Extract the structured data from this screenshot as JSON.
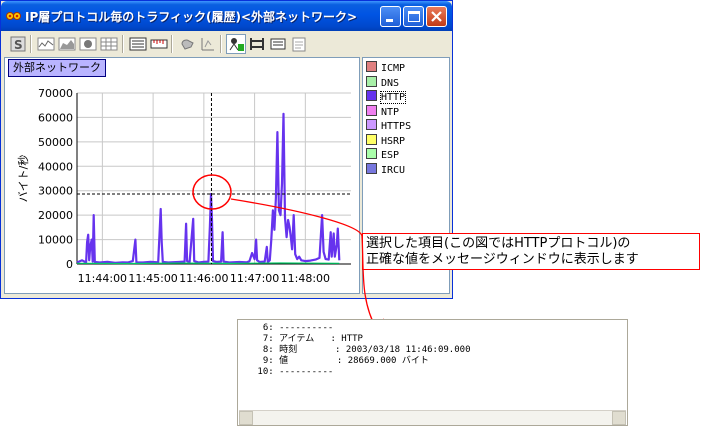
{
  "window": {
    "title": "IP層プロトコル毎のトラフィック(履歴)<外部ネットワーク>",
    "title_bar_color": "#0054e3"
  },
  "toolbar": {
    "buttons": [
      {
        "name": "summary-icon"
      },
      {
        "name": "line-graph-icon"
      },
      {
        "name": "area-graph-icon"
      },
      {
        "name": "pie-graph-icon"
      },
      {
        "name": "table-icon"
      },
      {
        "name": "list-view-icon"
      },
      {
        "name": "ruler-icon"
      },
      {
        "name": "hand-icon"
      },
      {
        "name": "zoom-icon"
      },
      {
        "name": "legend-icon"
      },
      {
        "name": "bars-icon"
      },
      {
        "name": "settings-icon"
      },
      {
        "name": "notepad-icon"
      }
    ]
  },
  "graph": {
    "series_label": "外部ネットワーク"
  },
  "chart_data": {
    "type": "line",
    "title": "外部ネットワーク",
    "ylabel": "バイト/秒",
    "xlabel": "",
    "ylim": [
      0,
      70000
    ],
    "yticks": [
      0,
      10000,
      20000,
      30000,
      40000,
      50000,
      60000,
      70000
    ],
    "xlim_min": [
      43.5,
      48.9
    ],
    "xtick_labels": [
      "11:44:00",
      "11:45:00",
      "11:46:00",
      "11:47:00",
      "11:48:00"
    ],
    "xtick_min": [
      44,
      45,
      46,
      47,
      48
    ],
    "grid": true,
    "cursor_min": 46.15,
    "reference_y": 28669,
    "series": [
      {
        "name": "HTTP",
        "color": "#6633ee",
        "points": [
          [
            43.5,
            600
          ],
          [
            43.6,
            1500
          ],
          [
            43.68,
            600
          ],
          [
            43.7,
            9000
          ],
          [
            43.72,
            12000
          ],
          [
            43.74,
            1500
          ],
          [
            43.76,
            7000
          ],
          [
            43.79,
            10000
          ],
          [
            43.81,
            1000
          ],
          [
            43.83,
            20000
          ],
          [
            43.85,
            800
          ],
          [
            43.95,
            600
          ],
          [
            44.1,
            900
          ],
          [
            44.25,
            500
          ],
          [
            44.4,
            700
          ],
          [
            44.5,
            600
          ],
          [
            44.6,
            1200
          ],
          [
            44.65,
            10000
          ],
          [
            44.67,
            700
          ],
          [
            44.8,
            600
          ],
          [
            44.95,
            900
          ],
          [
            45.1,
            700
          ],
          [
            45.15,
            22500
          ],
          [
            45.17,
            9000
          ],
          [
            45.19,
            800
          ],
          [
            45.3,
            600
          ],
          [
            45.5,
            800
          ],
          [
            45.62,
            1000
          ],
          [
            45.65,
            16500
          ],
          [
            45.67,
            1200
          ],
          [
            45.72,
            800
          ],
          [
            45.79,
            18500
          ],
          [
            45.81,
            1200
          ],
          [
            45.9,
            600
          ],
          [
            46.0,
            900
          ],
          [
            46.09,
            1000
          ],
          [
            46.12,
            15500
          ],
          [
            46.14,
            28669
          ],
          [
            46.16,
            18000
          ],
          [
            46.18,
            1200
          ],
          [
            46.25,
            800
          ],
          [
            46.34,
            1000
          ],
          [
            46.37,
            13000
          ],
          [
            46.39,
            1000
          ],
          [
            46.5,
            600
          ],
          [
            46.7,
            800
          ],
          [
            46.85,
            700
          ],
          [
            46.9,
            1200
          ],
          [
            46.95,
            4500
          ],
          [
            47.0,
            2000
          ],
          [
            47.03,
            10000
          ],
          [
            47.05,
            1500
          ],
          [
            47.1,
            800
          ],
          [
            47.2,
            1000
          ],
          [
            47.24,
            7000
          ],
          [
            47.26,
            800
          ],
          [
            47.3,
            1500
          ],
          [
            47.33,
            10000
          ],
          [
            47.36,
            22000
          ],
          [
            47.39,
            14000
          ],
          [
            47.42,
            27000
          ],
          [
            47.45,
            54000
          ],
          [
            47.48,
            22000
          ],
          [
            47.51,
            20000
          ],
          [
            47.54,
            33000
          ],
          [
            47.57,
            61500
          ],
          [
            47.6,
            19000
          ],
          [
            47.63,
            11000
          ],
          [
            47.66,
            18000
          ],
          [
            47.69,
            15000
          ],
          [
            47.72,
            10000
          ],
          [
            47.74,
            6000
          ],
          [
            47.77,
            20000
          ],
          [
            47.8,
            4000
          ],
          [
            47.84,
            2000
          ],
          [
            47.88,
            3000
          ],
          [
            47.92,
            1500
          ],
          [
            48.0,
            1200
          ],
          [
            48.1,
            1400
          ],
          [
            48.2,
            1800
          ],
          [
            48.28,
            2500
          ],
          [
            48.33,
            20000
          ],
          [
            48.36,
            5000
          ],
          [
            48.4,
            2000
          ],
          [
            48.46,
            1800
          ],
          [
            48.5,
            13000
          ],
          [
            48.52,
            3000
          ],
          [
            48.56,
            12500
          ],
          [
            48.58,
            3000
          ],
          [
            48.62,
            8000
          ],
          [
            48.64,
            14500
          ],
          [
            48.67,
            1500
          ]
        ]
      },
      {
        "name": "DNS",
        "color": "#00cc66",
        "points": [
          [
            43.5,
            300
          ],
          [
            44.5,
            200
          ],
          [
            45.5,
            350
          ],
          [
            46.5,
            250
          ],
          [
            47.5,
            400
          ],
          [
            48.67,
            300
          ]
        ]
      }
    ]
  },
  "legend": {
    "items": [
      {
        "label": "ICMP",
        "color": "#e08080",
        "selected": false
      },
      {
        "label": "DNS",
        "color": "#a8f0a8",
        "selected": false
      },
      {
        "label": "HTTP",
        "color": "#6633ee",
        "selected": true
      },
      {
        "label": "NTP",
        "color": "#f080f0",
        "selected": false
      },
      {
        "label": "HTTPS",
        "color": "#cc99ff",
        "selected": false
      },
      {
        "label": "HSRP",
        "color": "#ffff66",
        "selected": false
      },
      {
        "label": "ESP",
        "color": "#aaffaa",
        "selected": false
      },
      {
        "label": "IRCU",
        "color": "#7777dd",
        "selected": false
      }
    ]
  },
  "callout": {
    "line1": "選択した項目(この図ではHTTPプロトコル)の",
    "line2": "正確な値をメッセージウィンドウに表示します",
    "color": "#ff0000"
  },
  "message_window": {
    "lines": [
      "  6: ----------",
      "  7: アイテム   : HTTP",
      "  8: 時刻       : 2003/03/18 11:46:09.000",
      "  9: 値         : 28669.000 バイト",
      " 10: ----------"
    ]
  }
}
